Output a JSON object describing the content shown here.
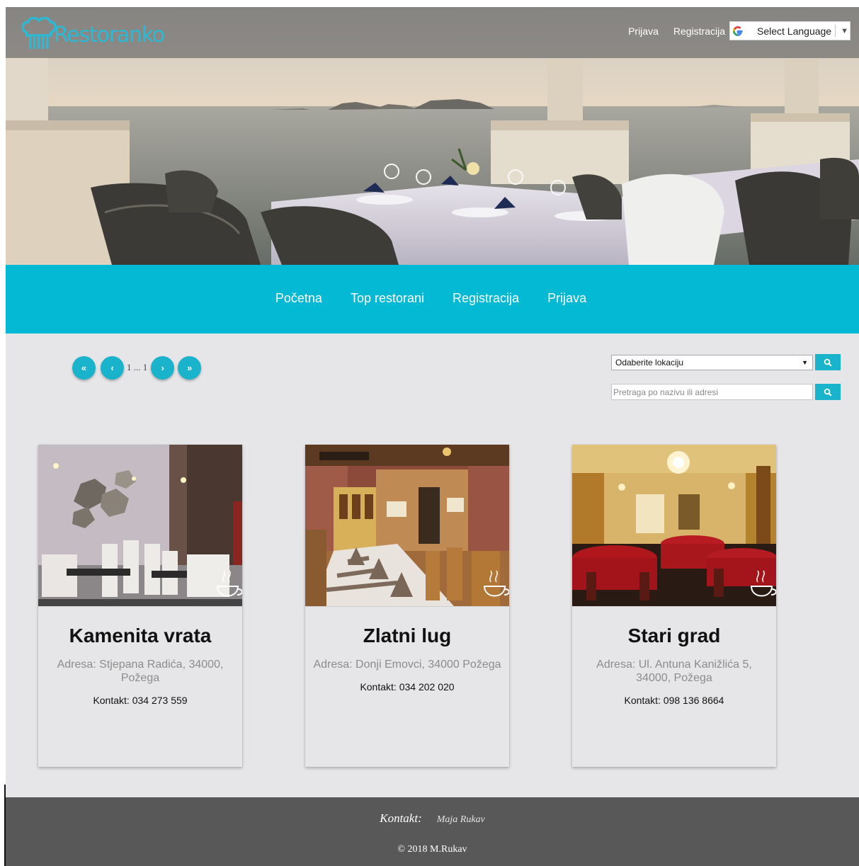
{
  "brand": {
    "name": "Restoranko",
    "accent": "#2bb9d3"
  },
  "header": {
    "links": [
      {
        "label": "Prijava"
      },
      {
        "label": "Registracija"
      }
    ],
    "language": {
      "label": "Select Language",
      "icon": "google-g-icon"
    }
  },
  "nav": {
    "background": "#04b9d3",
    "items": [
      {
        "label": "Početna"
      },
      {
        "label": "Top restorani"
      },
      {
        "label": "Registracija"
      },
      {
        "label": "Prijava"
      }
    ]
  },
  "pagination": {
    "first": "«",
    "prev": "‹",
    "range": "1 ... 1",
    "next": "›",
    "last": "»"
  },
  "filters": {
    "location_selected": "Odaberite lokaciju",
    "search_placeholder": "Pretraga po nazivu ili adresi",
    "button_icon": "search-icon"
  },
  "restaurants": [
    {
      "name": "Kamenita vrata",
      "address": "Adresa: Stjepana Radića, 34000, Požega",
      "contact": "Kontakt: 034 273 559"
    },
    {
      "name": "Zlatni lug",
      "address": "Adresa: Donji Emovci, 34000 Požega",
      "contact": "Kontakt: 034 202 020"
    },
    {
      "name": "Stari grad",
      "address": "Adresa: Ul. Antuna Kanižlića 5, 34000, Požega",
      "contact": "Kontakt: 098 136 8664"
    }
  ],
  "footer": {
    "contact_label": "Kontakt:",
    "contact_name": "Maja Rukav",
    "copyright": "© 2018 M.Rukav",
    "background": "#585858"
  }
}
